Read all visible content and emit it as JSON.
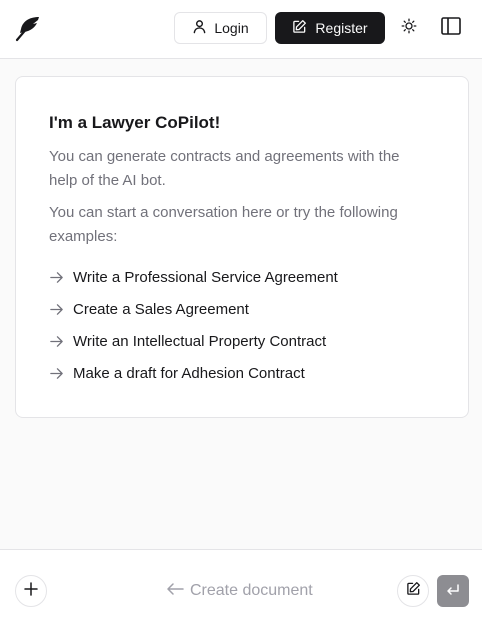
{
  "header": {
    "logo_icon": "feather-icon",
    "login_label": "Login",
    "register_label": "Register",
    "theme_icon": "sun-icon",
    "sidebar_icon": "sidebar-icon"
  },
  "card": {
    "title": "I'm a Lawyer CoPilot!",
    "paragraphs": [
      "You can generate contracts and agreements with the help of the AI bot.",
      "You can start a conversation here or try the following examples:"
    ],
    "examples": [
      "Write a Professional Service Agreement",
      "Create a Sales Agreement",
      "Write an Intellectual Property Contract",
      "Make a draft for Adhesion Contract"
    ]
  },
  "footer": {
    "add_icon": "plus-icon",
    "create_document_label": "Create document",
    "edit_icon": "edit-icon",
    "send_icon": "enter-icon"
  },
  "colors": {
    "primary": "#18181b",
    "muted_text": "#71717a",
    "border": "#e4e4e7",
    "send_disabled": "#8d8d92"
  }
}
